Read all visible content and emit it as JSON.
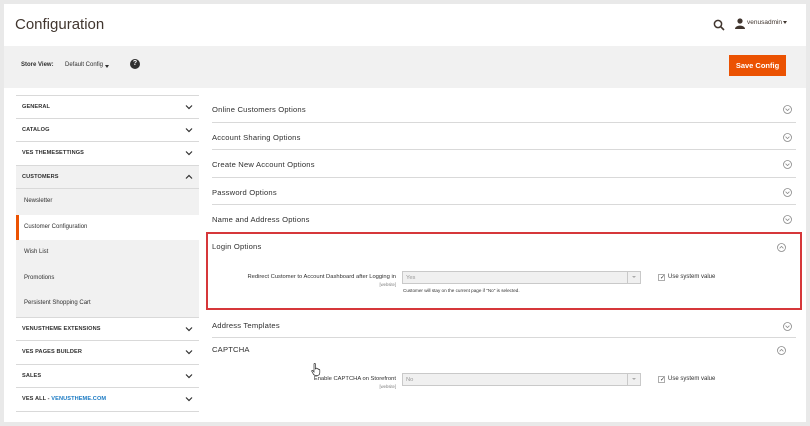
{
  "header": {
    "title": "Configuration",
    "user_name": "venusadmin"
  },
  "toolbar": {
    "store_view_label": "Store View:",
    "store_view_value": "Default Config",
    "save_label": "Save Config",
    "accent_color": "#eb5202"
  },
  "sidebar": {
    "tabs": [
      {
        "label": "GENERAL",
        "expanded": false
      },
      {
        "label": "CATALOG",
        "expanded": false
      },
      {
        "label": "VES THEMESETTINGS",
        "expanded": false
      },
      {
        "label": "CUSTOMERS",
        "expanded": true
      }
    ],
    "customer_items": [
      {
        "label": "Newsletter",
        "active": false
      },
      {
        "label": "Customer Configuration",
        "active": true
      },
      {
        "label": "Wish List",
        "active": false
      },
      {
        "label": "Promotions",
        "active": false
      },
      {
        "label": "Persistent Shopping Cart",
        "active": false
      }
    ],
    "tabs_after": [
      {
        "label": "VENUSTHEME EXTENSIONS"
      },
      {
        "label": "VES PAGES BUILDER"
      },
      {
        "label": "SALES"
      }
    ],
    "last_tab_prefix": "VES ALL - ",
    "last_tab_link": "VENUSTHEME.COM"
  },
  "sections": [
    {
      "title": "Online Customers Options"
    },
    {
      "title": "Account Sharing Options"
    },
    {
      "title": "Create New Account Options"
    },
    {
      "title": "Password Options"
    },
    {
      "title": "Name and Address Options"
    }
  ],
  "login_options": {
    "title": "Login Options",
    "field_label": "Redirect Customer to Account Dashboard after Logging in",
    "scope": "[website]",
    "value": "Yes",
    "note": "Customer will stay on the current page if \"No\" is selected.",
    "use_system_value": "Use system value",
    "highlight_color": "#d6373a"
  },
  "address_templates": {
    "title": "Address Templates"
  },
  "captcha": {
    "title": "CAPTCHA",
    "field_label": "Enable CAPTCHA on Storefront",
    "scope": "[website]",
    "value": "No",
    "use_system_value": "Use system value"
  }
}
